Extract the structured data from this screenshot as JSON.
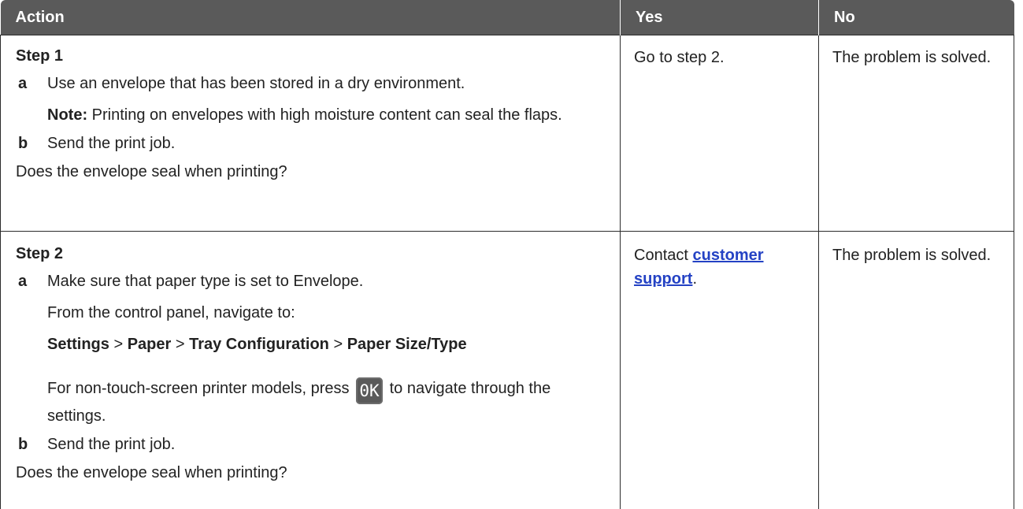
{
  "table": {
    "headers": {
      "action": "Action",
      "yes": "Yes",
      "no": "No"
    },
    "row1": {
      "step_title": "Step 1",
      "a_letter": "a",
      "a_text": "Use an envelope that has been stored in a dry environment.",
      "note_label": "Note:",
      "note_text": " Printing on envelopes with high moisture content can seal the flaps.",
      "b_letter": "b",
      "b_text": "Send the print job.",
      "question": "Does the envelope seal when printing?",
      "yes": "Go to step 2.",
      "no": "The problem is solved."
    },
    "row2": {
      "step_title": "Step 2",
      "a_letter": "a",
      "a_text": "Make sure that paper type is set to Envelope.",
      "nav_intro": "From the control panel, navigate to:",
      "path": [
        "Settings",
        "Paper",
        "Tray Configuration",
        "Paper Size/Type"
      ],
      "path_sep": " > ",
      "nontouch_before": "For non-touch-screen printer models, press ",
      "ok_key": "0K",
      "nontouch_after": " to navigate through the settings.",
      "b_letter": "b",
      "b_text": "Send the print job.",
      "question": "Does the envelope seal when printing?",
      "yes_prefix": "Contact ",
      "yes_link": "customer support",
      "yes_suffix": ".",
      "no": "The problem is solved."
    }
  }
}
